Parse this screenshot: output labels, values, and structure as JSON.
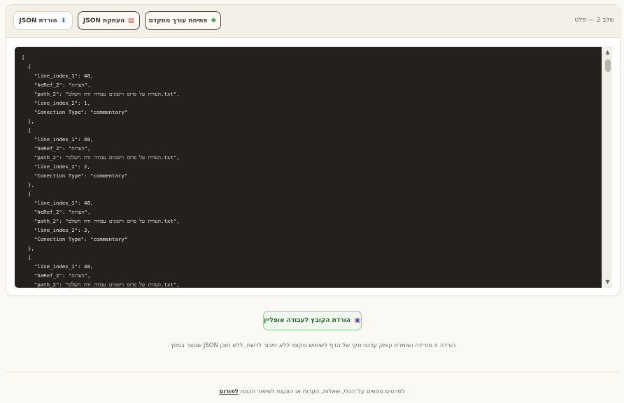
{
  "header": {
    "step_label": "שלב 2 — פלט",
    "download_button": "הורדת JSON",
    "copy_button": "העתקת JSON",
    "editor_button": "פתיחת עורך מתקדם"
  },
  "icons": {
    "download": "download-icon",
    "copy": "clipboard-icon",
    "editor": "sparkle-icon",
    "offline": "floppy-disk-icon"
  },
  "code_lines": [
    "[",
    "  {",
    "    \"line_index_1\": 48,",
    "    \"heRef_2\": \"הערות\",",
    "    \"path_2\": \"הערות על פרוס ריטונים עבודה זרה השלם.txt\",",
    "    \"line_index_2\": 1,",
    "    \"Conection Type\": \"commentary\"",
    "  },",
    "  {",
    "    \"line_index_1\": 48,",
    "    \"heRef_2\": \"הערות\",",
    "    \"path_2\": \"הערות על פרוס ריטונים עבודה זרה השלם.txt\",",
    "    \"line_index_2\": 2,",
    "    \"Conection Type\": \"commentary\"",
    "  },",
    "  {",
    "    \"line_index_1\": 48,",
    "    \"heRef_2\": \"הערות\",",
    "    \"path_2\": \"הערות על פרוס ריטונים עבודה זרה השלם.txt\",",
    "    \"line_index_2\": 3,",
    "    \"Conection Type\": \"commentary\"",
    "  },",
    "  {",
    "    \"line_index_1\": 48,",
    "    \"heRef_2\": \"הערות\",",
    "    \"path_2\": \"הערות על פרוס ריטונים עבודה זרה השלם.txt\","
  ],
  "offline": {
    "button_label": "הורדת הקובץ לעבודה אופליין",
    "note": "הורדה זו מורידה ושומרת עותק עדכני ונקי של הדף לשימוש מקומי ללא חיבור לרשת, ללא תוכן JSON שנוצר במסך."
  },
  "footer": {
    "text_before": "לפרטים נוספים על הכלי, שאלות, הערות או הצעות לשיפור הכנסו ",
    "link_label": "לפורום"
  }
}
